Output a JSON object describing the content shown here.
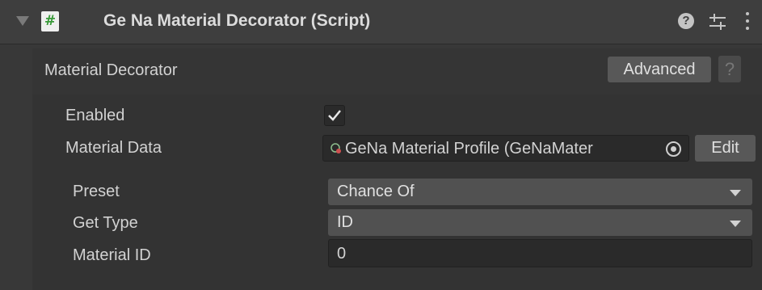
{
  "header": {
    "foldout_icon": "triangle-down-icon",
    "script_icon": "hash-icon",
    "script_icon_glyph": "#",
    "title": "Ge Na Material Decorator (Script)",
    "help_icon": "help-icon",
    "help_glyph": "?",
    "presets_icon": "sliders-icon",
    "menu_icon": "kebab-icon"
  },
  "section": {
    "title": "Material Decorator",
    "advanced_label": "Advanced",
    "help_glyph": "?"
  },
  "fields": {
    "enabled_label": "Enabled",
    "enabled_value": true,
    "material_data_label": "Material Data",
    "material_data_value": "GeNa Material Profile (GeNaMater",
    "edit_label": "Edit",
    "preset_label": "Preset",
    "preset_value": "Chance Of",
    "get_type_label": "Get Type",
    "get_type_value": "ID",
    "material_id_label": "Material ID",
    "material_id_value": "0"
  },
  "colors": {
    "background": "#383838",
    "header_bg": "#3e3e3e",
    "button_bg": "#585858",
    "dropdown_bg": "#515151",
    "field_bg": "#2a2a2a",
    "text": "#d2d2d2",
    "script_icon_accent": "#3a9a3a"
  }
}
